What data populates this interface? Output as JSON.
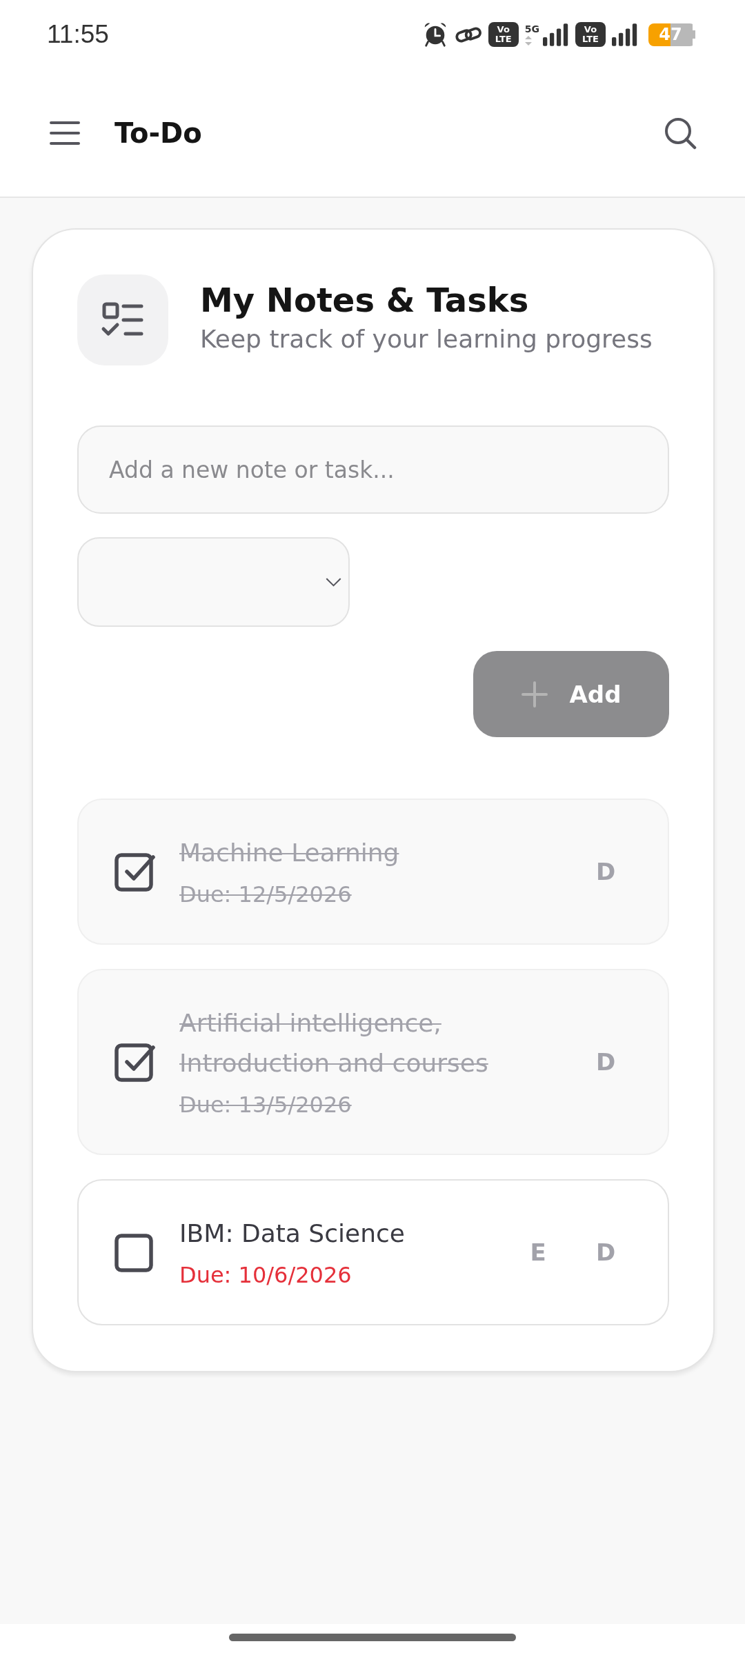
{
  "status_bar": {
    "time": "11:55",
    "sims": [
      {
        "badge": "Vo\nLTE",
        "network": "5G"
      },
      {
        "badge": "Vo\nLTE"
      }
    ],
    "battery": "47"
  },
  "app_bar": {
    "title": "To-Do"
  },
  "header": {
    "title": "My Notes & Tasks",
    "subtitle": "Keep track of your learning progress"
  },
  "new_item": {
    "placeholder": "Add a new note or task..."
  },
  "add_button": {
    "label": "Add",
    "disabled": true
  },
  "tasks": [
    {
      "title": "Machine Learning",
      "due": "Due: 12/5/2026",
      "checked": true,
      "actions": [
        "D"
      ]
    },
    {
      "title": "Artificial intelligence, Introduction and courses",
      "due": "Due: 13/5/2026",
      "checked": true,
      "actions": [
        "D"
      ]
    },
    {
      "title": "IBM: Data Science",
      "due": "Due: 10/6/2026",
      "checked": false,
      "actions": [
        "E",
        "D"
      ]
    }
  ]
}
